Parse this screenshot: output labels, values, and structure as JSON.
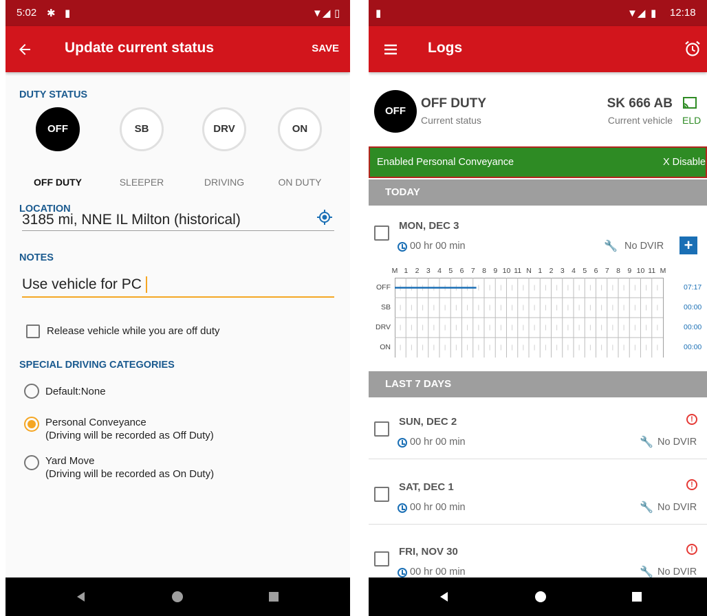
{
  "left": {
    "status_bar": {
      "time": "5:02"
    },
    "toolbar": {
      "title": "Update current status",
      "save": "SAVE"
    },
    "duty_status": {
      "heading": "DUTY STATUS",
      "options": [
        {
          "code": "OFF",
          "label": "OFF DUTY",
          "selected": true
        },
        {
          "code": "SB",
          "label": "SLEEPER",
          "selected": false
        },
        {
          "code": "DRV",
          "label": "DRIVING",
          "selected": false
        },
        {
          "code": "ON",
          "label": "ON DUTY",
          "selected": false
        }
      ]
    },
    "location": {
      "heading": "LOCATION",
      "value": "3185 mi, NNE IL Milton (historical)"
    },
    "notes": {
      "heading": "NOTES",
      "value": "Use vehicle for PC"
    },
    "release": {
      "label": "Release vehicle while you are off duty",
      "checked": false
    },
    "special": {
      "heading": "SPECIAL DRIVING CATEGORIES",
      "options": [
        {
          "label": "Default:None",
          "sub": "",
          "selected": false
        },
        {
          "label": "Personal Conveyance",
          "sub": "(Driving will be recorded as Off Duty)",
          "selected": true
        },
        {
          "label": "Yard Move",
          "sub": "(Driving will be recorded as On Duty)",
          "selected": false
        }
      ]
    }
  },
  "right": {
    "status_bar": {
      "time": "12:18"
    },
    "toolbar": {
      "title": "Logs"
    },
    "current": {
      "badge": "OFF",
      "status": "OFF DUTY",
      "status_caption": "Current status",
      "vehicle": "SK 666 AB",
      "vehicle_caption": "Current vehicle",
      "eld": "ELD"
    },
    "banner": {
      "text": "Enabled Personal Conveyance",
      "action": "X Disable"
    },
    "today": {
      "heading": "TODAY",
      "day": "MON, DEC 3",
      "duration": "00 hr  00 min",
      "dvir": "No DVIR",
      "grid": {
        "hour_labels": [
          "M",
          "1",
          "2",
          "3",
          "4",
          "5",
          "6",
          "7",
          "8",
          "9",
          "10",
          "11",
          "N",
          "1",
          "2",
          "3",
          "4",
          "5",
          "6",
          "7",
          "8",
          "9",
          "10",
          "11",
          "M"
        ],
        "rows": [
          "OFF",
          "SB",
          "DRV",
          "ON"
        ],
        "totals": [
          "07:17",
          "00:00",
          "00:00",
          "00:00"
        ],
        "off_duty_until_hour": 7.3
      }
    },
    "last7": {
      "heading": "LAST 7 DAYS",
      "days": [
        {
          "day": "SUN, DEC 2",
          "duration": "00 hr  00 min",
          "dvir": "No DVIR"
        },
        {
          "day": "SAT, DEC 1",
          "duration": "00 hr  00 min",
          "dvir": "No DVIR"
        },
        {
          "day": "FRI, NOV 30",
          "duration": "00 hr  00 min",
          "dvir": "No DVIR"
        }
      ]
    }
  },
  "colors": {
    "primary": "#d2151c",
    "status_bar": "#a31018",
    "accent": "#1a5a8f",
    "radio_selected": "#f5a623",
    "banner": "#2e8b24",
    "alert": "#e53935"
  }
}
